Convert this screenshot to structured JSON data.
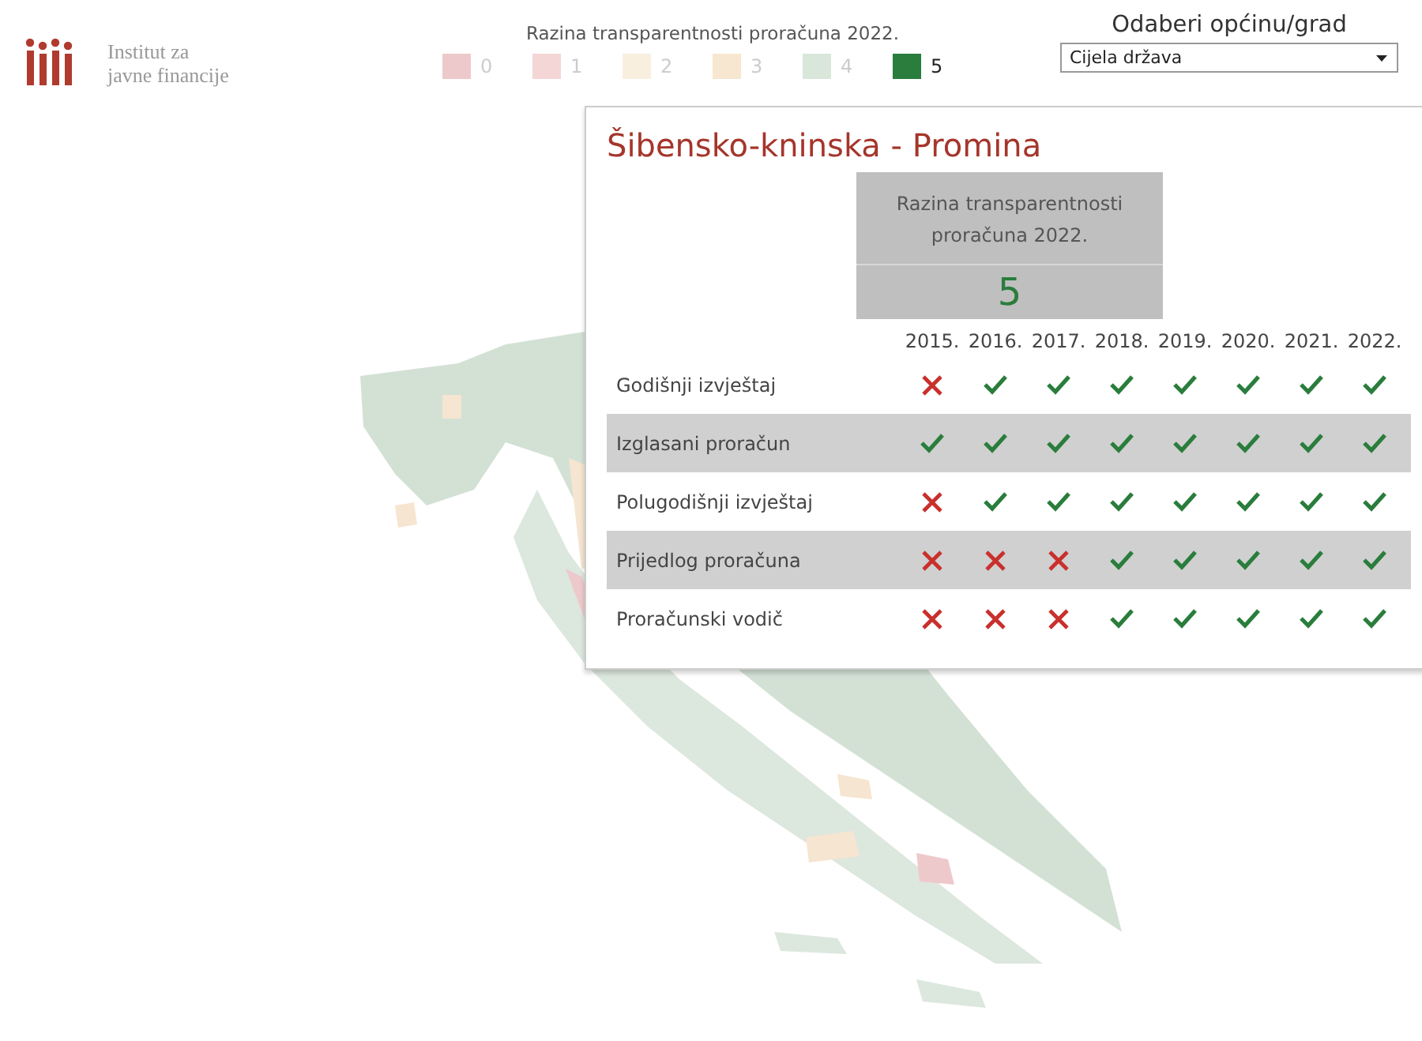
{
  "logo": {
    "line_1": "Institut za",
    "line_2": "javne financije"
  },
  "legend": {
    "title": "Razina transparentnosti proračuna 2022.",
    "items": [
      {
        "label": "0",
        "color": "#eec9cb",
        "selected": false
      },
      {
        "label": "1",
        "color": "#f3d6d5",
        "selected": false
      },
      {
        "label": "2",
        "color": "#f8efdf",
        "selected": false
      },
      {
        "label": "3",
        "color": "#f7e6d0",
        "selected": false
      },
      {
        "label": "4",
        "color": "#d9e6da",
        "selected": false
      },
      {
        "label": "5",
        "color": "#2a7d3c",
        "selected": true
      }
    ]
  },
  "filter": {
    "label": "Odaberi općinu/grad",
    "value": "Cijela država"
  },
  "tooltip": {
    "title": "Šibensko-kninska - Promina",
    "score_label": "Razina transparentnosti proračuna  2022.",
    "score": "5",
    "years": [
      "2015.",
      "2016.",
      "2017.",
      "2018.",
      "2019.",
      "2020.",
      "2021.",
      "2022."
    ],
    "rows": [
      {
        "label": "Godišnji izvještaj",
        "checks": [
          false,
          true,
          true,
          true,
          true,
          true,
          true,
          true
        ]
      },
      {
        "label": "Izglasani proračun",
        "checks": [
          true,
          true,
          true,
          true,
          true,
          true,
          true,
          true
        ]
      },
      {
        "label": "Polugodišnji izvještaj",
        "checks": [
          false,
          true,
          true,
          true,
          true,
          true,
          true,
          true
        ]
      },
      {
        "label": "Prijedlog proračuna",
        "checks": [
          false,
          false,
          false,
          true,
          true,
          true,
          true,
          true
        ]
      },
      {
        "label": "Proračunski vodič",
        "checks": [
          false,
          false,
          false,
          true,
          true,
          true,
          true,
          true
        ]
      }
    ]
  }
}
